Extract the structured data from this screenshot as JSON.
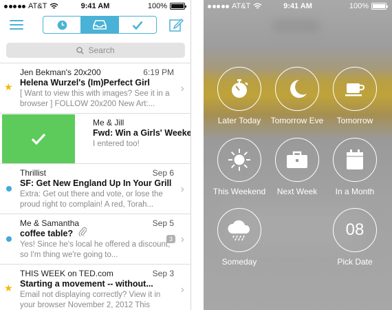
{
  "left": {
    "status": {
      "carrier": "AT&T",
      "time": "9:41 AM",
      "battery": "100%"
    },
    "toolbar": {
      "tabs": [
        {
          "icon": "clock-icon",
          "active": false
        },
        {
          "icon": "inbox-icon",
          "active": true
        },
        {
          "icon": "checkmark-icon",
          "active": false
        }
      ]
    },
    "search": {
      "placeholder": "Search"
    },
    "emails": [
      {
        "sender": "Jen Bekman's 20x200",
        "time": "6:19 PM",
        "subject": "Helena Wurzel's (Im)Perfect Girl",
        "preview": "[ Want to view this with images? See it in a browser ] FOLLOW 20x200 New Art:...",
        "marker": "star"
      },
      {
        "sender": "Me & Jill",
        "time": "",
        "subject": "Fwd: Win a Girls' Weeke",
        "preview": "I entered too!",
        "marker": "none"
      },
      {
        "sender": "Thrillist",
        "time": "Sep 6",
        "subject": "SF: Get New England Up In Your Grill",
        "preview": "Extra: Get out there and vote, or lose the proud right to complain! A red, Torah...",
        "marker": "dot"
      },
      {
        "sender": "Me & Samantha",
        "time": "Sep 5",
        "subject": "coffee table?",
        "preview": "Yes! Since he's local he offered a discount, so I'm thing we're going to...",
        "marker": "dot",
        "badge": "3"
      },
      {
        "sender": "THIS WEEK on TED.com",
        "time": "Sep 3",
        "subject": "Starting a movement -- without...",
        "preview": "Email not displaying correctly? View it in your browser November 2, 2012 This wee...",
        "marker": "star"
      }
    ]
  },
  "right": {
    "status": {
      "carrier": "AT&T",
      "time": "9:41 AM",
      "battery": "100%"
    },
    "options": [
      {
        "label": "Later Today",
        "icon": "stopwatch-icon"
      },
      {
        "label": "Tomorrow Eve",
        "icon": "moon-icon"
      },
      {
        "label": "Tomorrow",
        "icon": "coffee-cup-icon"
      },
      {
        "label": "This Weekend",
        "icon": "sun-icon"
      },
      {
        "label": "Next Week",
        "icon": "briefcase-icon"
      },
      {
        "label": "In a Month",
        "icon": "calendar-icon"
      },
      {
        "label": "Someday",
        "icon": "cloud-rain-icon"
      },
      {
        "label": "Pick Date",
        "icon": "date-number",
        "number": "08"
      }
    ]
  },
  "colors": {
    "accent": "#4ab2d6",
    "swipe_green": "#5dcb5c",
    "star": "#f5b800",
    "unread_dot": "#42a9d8",
    "highlight_band": "#bfa33a"
  }
}
